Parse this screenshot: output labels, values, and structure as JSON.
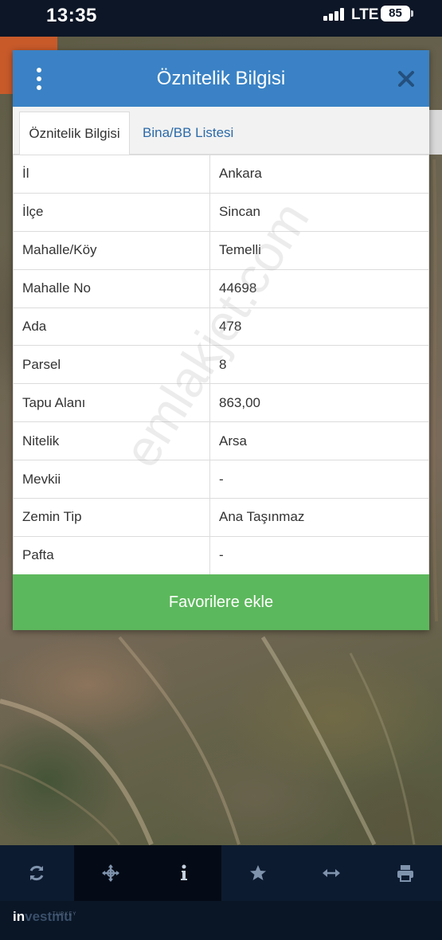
{
  "status_bar": {
    "time": "13:35",
    "network": "LTE",
    "battery": "85"
  },
  "dialog": {
    "title": "Öznitelik Bilgisi",
    "tabs": [
      {
        "label": "Öznitelik Bilgisi",
        "active": true
      },
      {
        "label": "Bina/BB Listesi",
        "active": false
      }
    ],
    "rows": [
      {
        "key": "İl",
        "value": "Ankara"
      },
      {
        "key": "İlçe",
        "value": "Sincan"
      },
      {
        "key": "Mahalle/Köy",
        "value": "Temelli"
      },
      {
        "key": "Mahalle No",
        "value": "44698"
      },
      {
        "key": "Ada",
        "value": "478"
      },
      {
        "key": "Parsel",
        "value": "8"
      },
      {
        "key": "Tapu Alanı",
        "value": "863,00"
      },
      {
        "key": "Nitelik",
        "value": "Arsa"
      },
      {
        "key": "Mevkii",
        "value": "-"
      },
      {
        "key": "Zemin Tip",
        "value": "Ana Taşınmaz"
      },
      {
        "key": "Pafta",
        "value": "-"
      }
    ],
    "favorite_button": "Favorilere ekle"
  },
  "watermark": "emlakjet.com",
  "toolbar": {
    "items": [
      {
        "icon": "refresh-icon",
        "active": false
      },
      {
        "icon": "crosshair-move-icon",
        "active": true
      },
      {
        "icon": "info-icon",
        "active": true
      },
      {
        "icon": "star-icon",
        "active": false
      },
      {
        "icon": "measure-arrows-icon",
        "active": false
      },
      {
        "icon": "print-icon",
        "active": false
      }
    ]
  },
  "footer": {
    "logo_prefix": "in",
    "logo_rest": "vestmu",
    "logo_small": "TURKEY"
  },
  "colors": {
    "header_blue": "#3a82c5",
    "button_green": "#5cb85c",
    "tab_link_blue": "#2b6aa8",
    "toolbar_dark": "#0d1b30"
  }
}
